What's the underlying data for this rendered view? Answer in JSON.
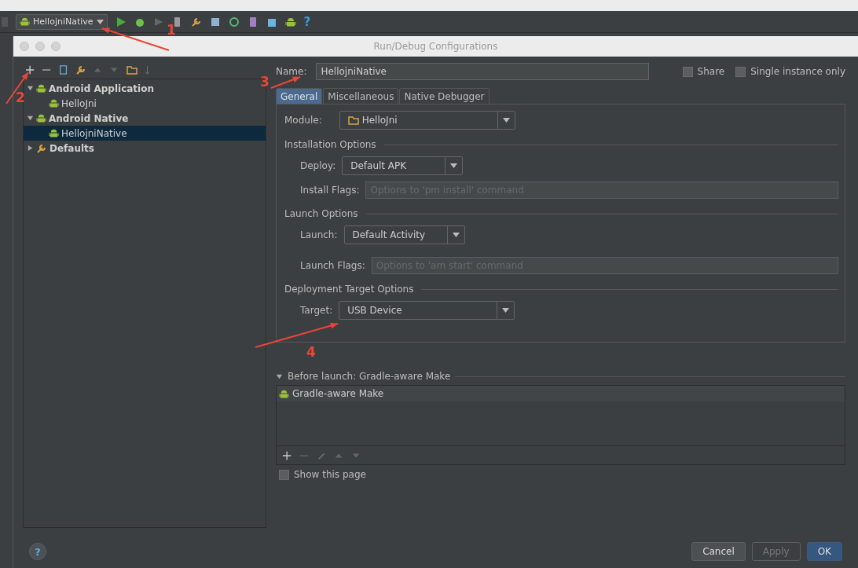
{
  "toolbar": {
    "run_config": "HellojniNative",
    "help": "?"
  },
  "help": "?",
  "dialog": {
    "title": "Run/Debug Configurations"
  },
  "tree": [
    {
      "label": "Android Application",
      "expanded": true,
      "selected": false,
      "children": [
        {
          "label": "HelloJni",
          "selected": false
        }
      ]
    },
    {
      "label": "Android Native",
      "expanded": true,
      "selected": false,
      "children": [
        {
          "label": "HellojniNative",
          "selected": true
        }
      ]
    },
    {
      "label": "Defaults",
      "expanded": false,
      "selected": false
    }
  ],
  "name": {
    "label": "Name:",
    "value": "HellojniNative"
  },
  "options": [
    {
      "label": "Share",
      "checked": false
    },
    {
      "label": "Single instance only",
      "checked": false
    }
  ],
  "tabs": [
    {
      "label": "General",
      "selected": true
    },
    {
      "label": "Miscellaneous",
      "selected": false
    },
    {
      "label": "Native Debugger",
      "selected": false
    }
  ],
  "module": {
    "label": "Module:",
    "value": "HelloJni"
  },
  "sections": [
    {
      "title": "Installation Options",
      "rows": [
        {
          "kind": "select",
          "label": "Deploy:",
          "value": "Default APK"
        },
        {
          "kind": "text",
          "label": "Install Flags:",
          "placeholder": "Options to 'pm install' command"
        }
      ]
    },
    {
      "title": "Launch Options",
      "rows": [
        {
          "kind": "select",
          "label": "Launch:",
          "value": "Default Activity"
        },
        {
          "kind": "text",
          "label": "Launch Flags:",
          "placeholder": "Options to 'am start' command"
        }
      ]
    },
    {
      "title": "Deployment Target Options",
      "rows": [
        {
          "kind": "wideselect",
          "label": "Target:",
          "value": "USB Device"
        }
      ]
    }
  ],
  "before_launch": {
    "title": "Before launch: Gradle-aware Make",
    "expanded": true,
    "tasks": [
      "Gradle-aware Make"
    ],
    "show_page": {
      "label": "Show this page",
      "checked": false
    }
  },
  "buttons": [
    {
      "label": "Cancel",
      "kind": "normal"
    },
    {
      "label": "Apply",
      "kind": "disabled"
    },
    {
      "label": "OK",
      "kind": "default"
    }
  ],
  "annotations": [
    {
      "label": "1"
    },
    {
      "label": "2"
    },
    {
      "label": "3"
    },
    {
      "label": "4"
    }
  ]
}
